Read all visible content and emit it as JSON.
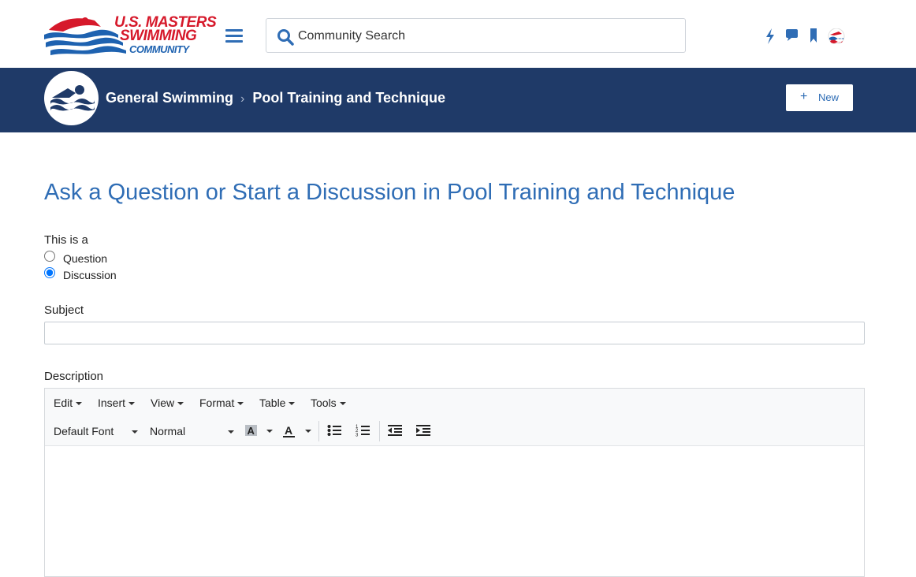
{
  "header": {
    "logo_line1": "U.S. MASTERS",
    "logo_line2": "SWIMMING",
    "logo_line3": "COMMUNITY",
    "search_placeholder": "Community Search",
    "icons": [
      "lightning-icon",
      "chat-bubble-icon",
      "bookmark-icon",
      "user-avatar-icon"
    ]
  },
  "banner": {
    "breadcrumb_parent": "General Swimming",
    "breadcrumb_current": "Pool Training and Technique",
    "new_button_label": "New"
  },
  "main": {
    "title": "Ask a Question or Start a Discussion in Pool Training and Technique",
    "type_label": "This is a",
    "options": [
      {
        "label": "Question",
        "selected": false
      },
      {
        "label": "Discussion",
        "selected": true
      }
    ],
    "subject_label": "Subject",
    "subject_value": "",
    "description_label": "Description"
  },
  "editor": {
    "menus": [
      "Edit",
      "Insert",
      "View",
      "Format",
      "Table",
      "Tools"
    ],
    "font_select": "Default Font",
    "size_select": "Normal"
  },
  "colors": {
    "brand_blue": "#2f6db5",
    "banner_navy": "#1f3a68",
    "logo_red": "#d6192b"
  }
}
